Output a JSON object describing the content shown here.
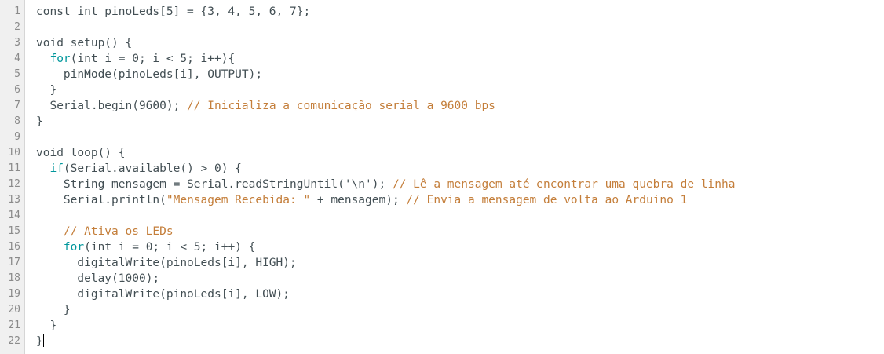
{
  "editor": {
    "lines": [
      {
        "n": "1",
        "parts": [
          {
            "t": "const int pinoLeds[5] = {3, 4, 5, 6, 7};",
            "c": ""
          }
        ]
      },
      {
        "n": "2",
        "parts": []
      },
      {
        "n": "3",
        "parts": [
          {
            "t": "void setup() {",
            "c": ""
          }
        ]
      },
      {
        "n": "4",
        "parts": [
          {
            "t": "  ",
            "c": ""
          },
          {
            "t": "for",
            "c": "kw"
          },
          {
            "t": "(int i = 0; i < 5; i++){",
            "c": ""
          }
        ]
      },
      {
        "n": "5",
        "parts": [
          {
            "t": "    pinMode(pinoLeds[i], OUTPUT);",
            "c": ""
          }
        ]
      },
      {
        "n": "6",
        "parts": [
          {
            "t": "  }",
            "c": ""
          }
        ]
      },
      {
        "n": "7",
        "parts": [
          {
            "t": "  Serial.begin(",
            "c": ""
          },
          {
            "t": "9600",
            "c": ""
          },
          {
            "t": "); ",
            "c": ""
          },
          {
            "t": "// Inicializa a comunicação serial a 9600 bps",
            "c": "cmt"
          }
        ]
      },
      {
        "n": "8",
        "parts": [
          {
            "t": "}",
            "c": ""
          }
        ]
      },
      {
        "n": "9",
        "parts": []
      },
      {
        "n": "10",
        "parts": [
          {
            "t": "void loop() {",
            "c": ""
          }
        ]
      },
      {
        "n": "11",
        "parts": [
          {
            "t": "  ",
            "c": ""
          },
          {
            "t": "if",
            "c": "kw"
          },
          {
            "t": "(Serial.available() > 0) {",
            "c": ""
          }
        ]
      },
      {
        "n": "12",
        "parts": [
          {
            "t": "    String mensagem = Serial.readStringUntil('\\n'); ",
            "c": ""
          },
          {
            "t": "// Lê a mensagem até encontrar uma quebra de linha",
            "c": "cmt"
          }
        ]
      },
      {
        "n": "13",
        "parts": [
          {
            "t": "    Serial.println(",
            "c": ""
          },
          {
            "t": "\"Mensagem Recebida: \"",
            "c": "cmt"
          },
          {
            "t": " + mensagem); ",
            "c": ""
          },
          {
            "t": "// Envia a mensagem de volta ao Arduino 1",
            "c": "cmt"
          }
        ]
      },
      {
        "n": "14",
        "parts": []
      },
      {
        "n": "15",
        "parts": [
          {
            "t": "    ",
            "c": ""
          },
          {
            "t": "// Ativa os LEDs",
            "c": "cmt"
          }
        ]
      },
      {
        "n": "16",
        "parts": [
          {
            "t": "    ",
            "c": ""
          },
          {
            "t": "for",
            "c": "kw"
          },
          {
            "t": "(int i = 0; i < 5; i++) {",
            "c": ""
          }
        ]
      },
      {
        "n": "17",
        "parts": [
          {
            "t": "      digitalWrite(pinoLeds[i], HIGH);",
            "c": ""
          }
        ]
      },
      {
        "n": "18",
        "parts": [
          {
            "t": "      delay(",
            "c": ""
          },
          {
            "t": "1000",
            "c": ""
          },
          {
            "t": ");",
            "c": ""
          }
        ]
      },
      {
        "n": "19",
        "parts": [
          {
            "t": "      digitalWrite(pinoLeds[i], LOW);",
            "c": ""
          }
        ]
      },
      {
        "n": "20",
        "parts": [
          {
            "t": "    }",
            "c": ""
          }
        ]
      },
      {
        "n": "21",
        "parts": [
          {
            "t": "  }",
            "c": ""
          }
        ]
      },
      {
        "n": "22",
        "parts": [
          {
            "t": "}",
            "c": ""
          }
        ],
        "cursor": true
      }
    ]
  }
}
